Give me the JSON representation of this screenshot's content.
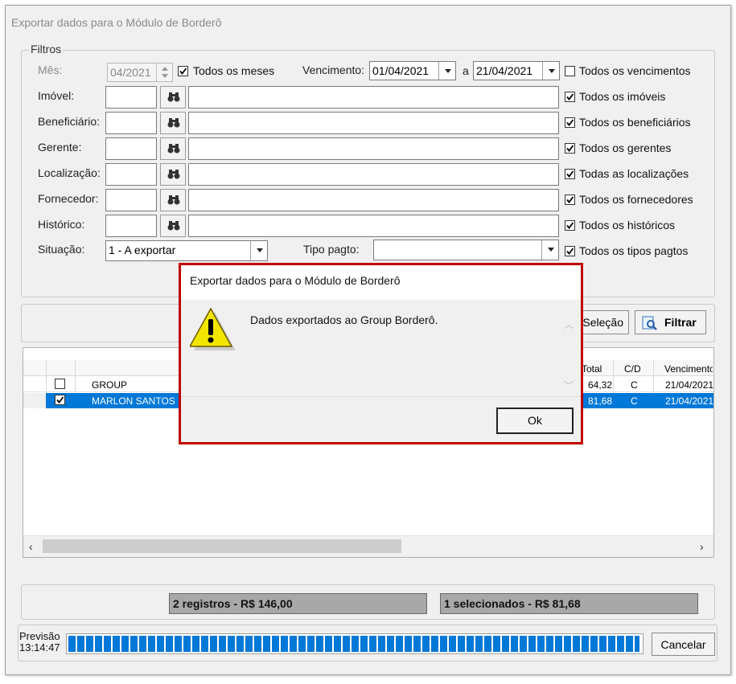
{
  "window": {
    "title": "Exportar dados para o Módulo de Borderô"
  },
  "filters": {
    "legend": "Filtros",
    "month": {
      "label": "Mês:",
      "value": "04/2021",
      "all_label": "Todos os meses",
      "all_checked": true
    },
    "due": {
      "label": "Vencimento:",
      "from": "01/04/2021",
      "sep": "a",
      "to": "21/04/2021",
      "all_label": "Todos os vencimentos",
      "all_checked": false
    },
    "rows": [
      {
        "label": "Imóvel:",
        "all_label": "Todos os imóveis"
      },
      {
        "label": "Beneficiário:",
        "all_label": "Todos os beneficiários"
      },
      {
        "label": "Gerente:",
        "all_label": "Todos os gerentes"
      },
      {
        "label": "Localização:",
        "all_label": "Todas as localizações"
      },
      {
        "label": "Fornecedor:",
        "all_label": "Todos os fornecedores"
      },
      {
        "label": "Histórico:",
        "all_label": "Todos os históricos"
      }
    ],
    "situacao": {
      "label": "Situação:",
      "value": "1 - A exportar"
    },
    "tipo_pagto": {
      "label": "Tipo pagto:",
      "value": "",
      "all_label": "Todos os tipos pagtos"
    }
  },
  "actions": {
    "selection_label": "Seleção",
    "filter_label": "Filtrar"
  },
  "grid": {
    "columns": {
      "total": "Total",
      "cd": "C/D",
      "due": "Vencimento"
    },
    "rows": [
      {
        "name": "GROUP",
        "checked": false,
        "total": "64,32",
        "cd": "C",
        "due": "21/04/2021"
      },
      {
        "name": "MARLON SANTOS",
        "checked": true,
        "total": "81,68",
        "cd": "C",
        "due": "21/04/2021"
      }
    ]
  },
  "totals": {
    "records": "2 registros - R$ 146,00",
    "selected": "1 selecionados - R$ 81,68"
  },
  "footer": {
    "forecast_label": "Previsão",
    "forecast_time": "13:14:47",
    "progress": 1.0,
    "cancel_label": "Cancelar"
  },
  "modal": {
    "title": "Exportar dados para o Módulo de Borderô",
    "message": "Dados exportados ao Group Borderô.",
    "ok_label": "Ok",
    "icon": "warning-icon"
  },
  "colors": {
    "selection": "#0078d7",
    "progress": "#0078d7",
    "modal_border": "#c00000",
    "warning": "#f2e600"
  }
}
